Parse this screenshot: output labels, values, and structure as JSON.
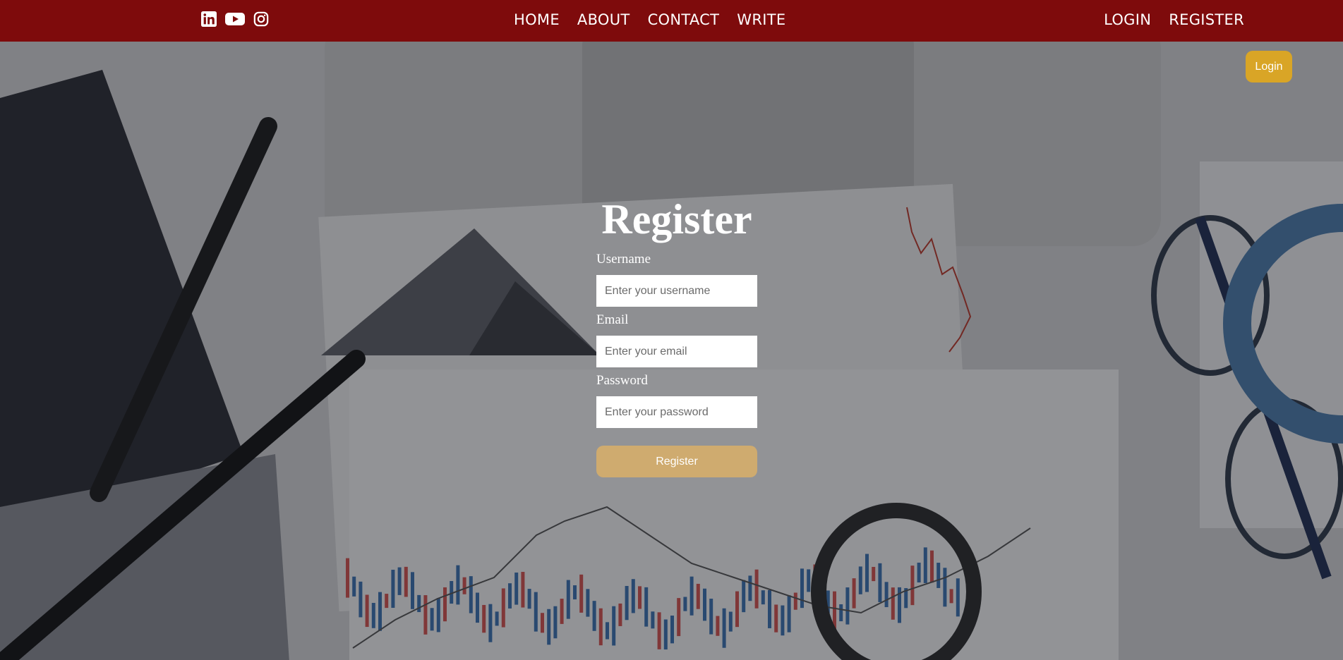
{
  "topbar": {
    "social_icons": [
      "linkedin-icon",
      "youtube-icon",
      "instagram-icon"
    ],
    "nav": [
      "HOME",
      "ABOUT",
      "CONTACT",
      "WRITE"
    ],
    "auth": [
      "LOGIN",
      "REGISTER"
    ],
    "background_color": "#7e0b0c"
  },
  "float_login": {
    "label": "Login",
    "color": "#d9a526"
  },
  "form": {
    "title": "Register",
    "fields": [
      {
        "label": "Username",
        "placeholder": "Enter your username",
        "type": "text"
      },
      {
        "label": "Email",
        "placeholder": "Enter your email",
        "type": "email"
      },
      {
        "label": "Password",
        "placeholder": "Enter your password",
        "type": "password"
      }
    ],
    "submit_label": "Register",
    "submit_color": "#cfab6f"
  }
}
